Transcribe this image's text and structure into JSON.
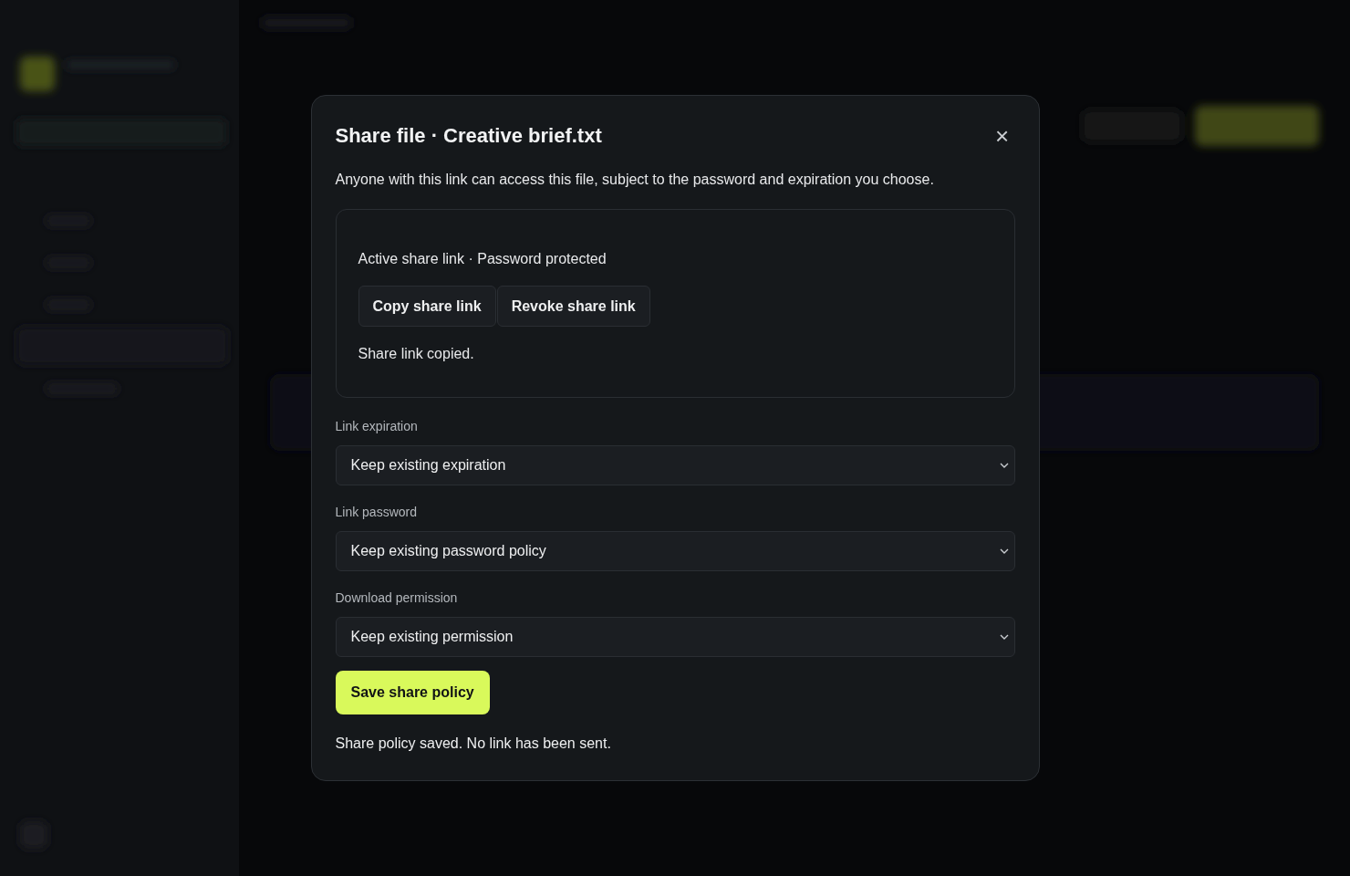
{
  "dialog": {
    "title": "Share file · Creative brief.txt",
    "close": "×",
    "description": "Anyone with this link can access this file, subject to the password and expiration you choose.",
    "link_panel": {
      "status": "Active share link · Password protected",
      "buttons": [
        "Copy share link",
        "Revoke share link"
      ],
      "message": "Share link copied."
    },
    "fields": [
      {
        "label": "Link expiration",
        "value": "Keep existing expiration"
      },
      {
        "label": "Link password",
        "value": "Keep existing password policy"
      },
      {
        "label": "Download permission",
        "value": "Keep existing permission"
      }
    ],
    "save_button": "Save share policy",
    "footer_message": "Share policy saved. No link has been sent."
  }
}
